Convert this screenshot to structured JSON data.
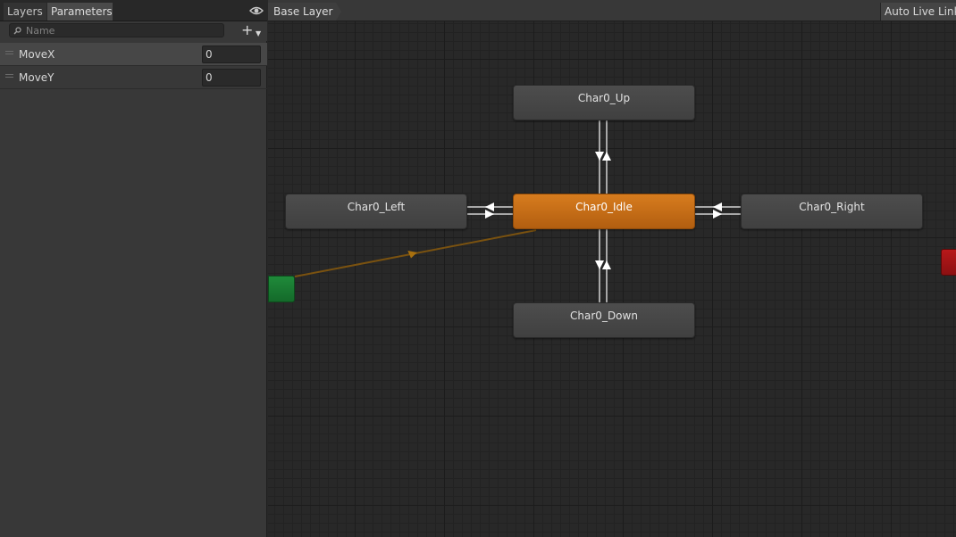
{
  "panel_tabs": {
    "layers": "Layers",
    "parameters": "Parameters"
  },
  "search": {
    "placeholder": "Name"
  },
  "parameters": [
    {
      "name": "MoveX",
      "value": "0"
    },
    {
      "name": "MoveY",
      "value": "0"
    }
  ],
  "graph": {
    "breadcrumb": "Base Layer",
    "auto_live_link": "Auto Live Link",
    "states": {
      "up": "Char0_Up",
      "left": "Char0_Left",
      "idle": "Char0_Idle",
      "right": "Char0_Right",
      "down": "Char0_Down"
    }
  },
  "colors": {
    "default_state": "#d07619",
    "entry": "#1a7d34",
    "exit": "#a81416",
    "default_transition": "#8a5a10"
  },
  "icons": {
    "eye": "eye-icon",
    "search": "search-icon",
    "add": "plus-icon"
  }
}
